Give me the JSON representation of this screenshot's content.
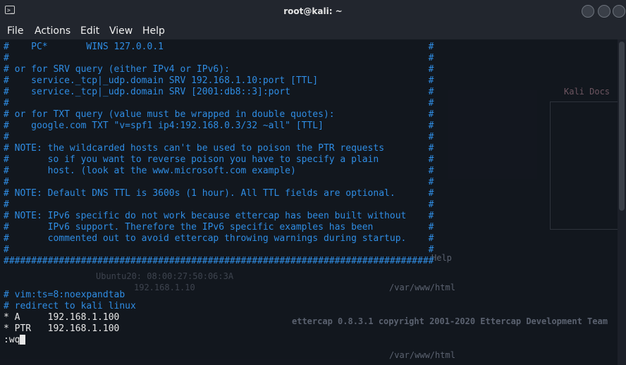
{
  "window": {
    "title": "root@kali: ~",
    "icon": "terminal-icon"
  },
  "menu": [
    {
      "label": "File"
    },
    {
      "label": "Actions"
    },
    {
      "label": "Edit"
    },
    {
      "label": "View"
    },
    {
      "label": "Help"
    }
  ],
  "terminal": {
    "lines": [
      {
        "text": "#    PC*       WINS 127.0.0.1                                                #",
        "style": "comment"
      },
      {
        "text": "#                                                                            #",
        "style": "comment"
      },
      {
        "text": "# or for SRV query (either IPv4 or IPv6):                                    #",
        "style": "comment"
      },
      {
        "text": "#    service._tcp|_udp.domain SRV 192.168.1.10:port [TTL]                    #",
        "style": "comment"
      },
      {
        "text": "#    service._tcp|_udp.domain SRV [2001:db8::3]:port                         #",
        "style": "comment"
      },
      {
        "text": "#                                                                            #",
        "style": "comment"
      },
      {
        "text": "# or for TXT query (value must be wrapped in double quotes):                 #",
        "style": "comment"
      },
      {
        "text": "#    google.com TXT \"v=spf1 ip4:192.168.0.3/32 ~all\" [TTL]                   #",
        "style": "comment"
      },
      {
        "text": "#                                                                            #",
        "style": "comment"
      },
      {
        "text": "# NOTE: the wildcarded hosts can't be used to poison the PTR requests        #",
        "style": "comment"
      },
      {
        "text": "#       so if you want to reverse poison you have to specify a plain         #",
        "style": "comment"
      },
      {
        "text": "#       host. (look at the www.microsoft.com example)                        #",
        "style": "comment"
      },
      {
        "text": "#                                                                            #",
        "style": "comment"
      },
      {
        "text": "# NOTE: Default DNS TTL is 3600s (1 hour). All TTL fields are optional.      #",
        "style": "comment"
      },
      {
        "text": "#                                                                            #",
        "style": "comment"
      },
      {
        "text": "# NOTE: IPv6 specific do not work because ettercap has been built without    #",
        "style": "comment"
      },
      {
        "text": "#       IPv6 support. Therefore the IPv6 specific examples has been          #",
        "style": "comment"
      },
      {
        "text": "#       commented out to avoid ettercap throwing warnings during startup.    #",
        "style": "comment"
      },
      {
        "text": "#                                                                            #",
        "style": "comment"
      },
      {
        "text": "##############################################################################",
        "style": "comment"
      },
      {
        "text": "",
        "style": "comment"
      },
      {
        "text": "",
        "style": "comment"
      },
      {
        "text": "# vim:ts=8:noexpandtab",
        "style": "comment"
      },
      {
        "text": "# redirect to kali linux",
        "style": "comment"
      },
      {
        "text": "* A     192.168.1.100",
        "style": "plain"
      },
      {
        "text": "* PTR   192.168.1.100",
        "style": "plain"
      },
      {
        "text": ":wq",
        "style": "plain",
        "cursor": true
      }
    ]
  },
  "background": {
    "texts": [
      "Kali Docs",
      "Help",
      "/var/www/html",
      "ettercap 0.8.3.1 copyright 2001-2020 Ettercap Development Team",
      "/var/www/html",
      "Ubuntu20: 08:00:27:50:06:3A",
      "192.168.1.10"
    ]
  }
}
